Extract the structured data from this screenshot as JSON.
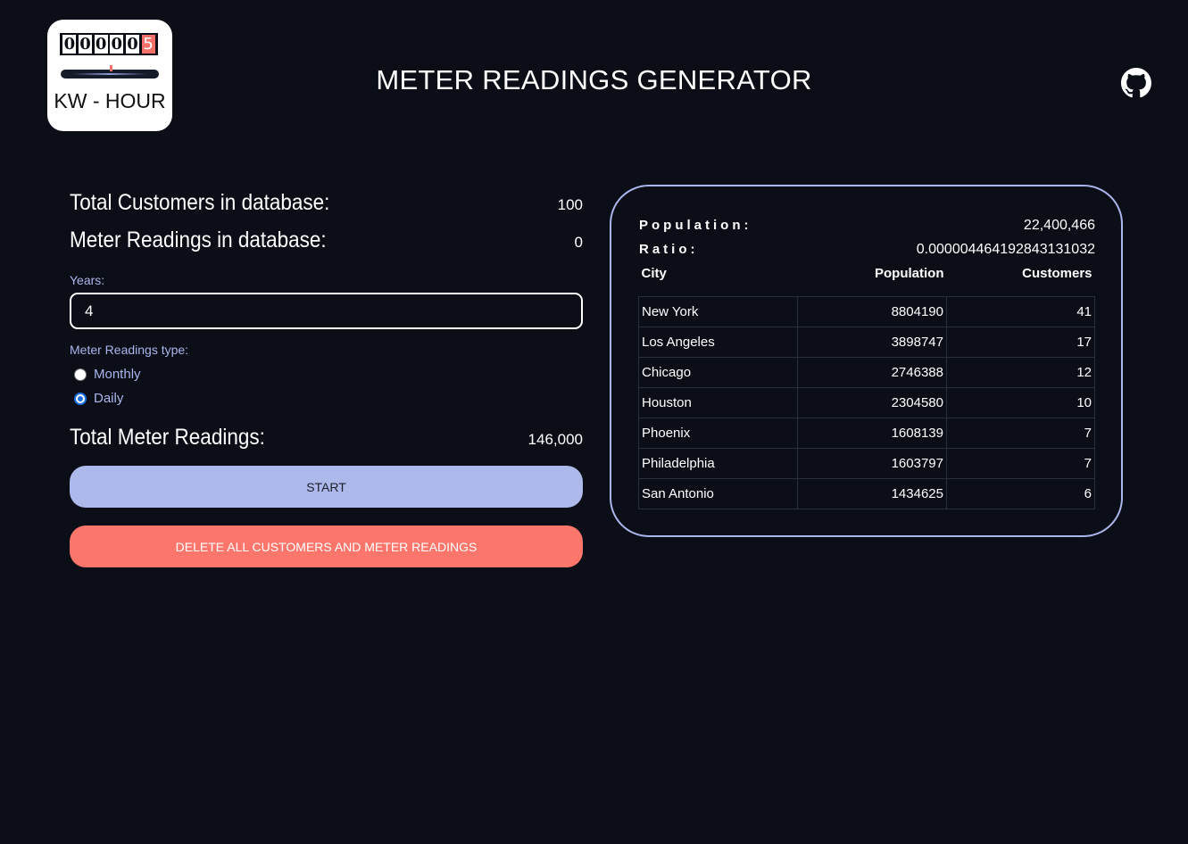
{
  "logo": {
    "digits": [
      "0",
      "0",
      "0",
      "0",
      "0",
      "5"
    ],
    "text": "KW - HOUR"
  },
  "header": {
    "title": "METER READINGS GENERATOR",
    "github_icon": "github-icon"
  },
  "stats": {
    "customers_label": "Total Customers in database:",
    "customers_value": "100",
    "readings_label": "Meter Readings in database:",
    "readings_value": "0"
  },
  "form": {
    "years_label": "Years:",
    "years_value": "4",
    "type_label": "Meter Readings type:",
    "options": [
      {
        "label": "Monthly",
        "checked": false
      },
      {
        "label": "Daily",
        "checked": true
      }
    ],
    "total_label": "Total Meter Readings:",
    "total_value": "146,000",
    "start_label": "START",
    "delete_label": "DELETE ALL CUSTOMERS AND METER READINGS"
  },
  "panel": {
    "population_label": "Population:",
    "population_value": "22,400,466",
    "ratio_label": "Ratio:",
    "ratio_value": "0.0000044641928431310 32",
    "columns": [
      "City",
      "Population",
      "Customers"
    ],
    "rows": [
      {
        "city": "New York",
        "population": "8804190",
        "customers": "41"
      },
      {
        "city": "Los Angeles",
        "population": "3898747",
        "customers": "17"
      },
      {
        "city": "Chicago",
        "population": "2746388",
        "customers": "12"
      },
      {
        "city": "Houston",
        "population": "2304580",
        "customers": "10"
      },
      {
        "city": "Phoenix",
        "population": "1608139",
        "customers": "7"
      },
      {
        "city": "Philadelphia",
        "population": "1603797",
        "customers": "7"
      },
      {
        "city": "San Antonio",
        "population": "1434625",
        "customers": "6"
      }
    ]
  },
  "colors": {
    "background": "#0b0e17",
    "accent": "#adb8eb",
    "danger": "#fc766c",
    "label": "#aab6ec"
  }
}
